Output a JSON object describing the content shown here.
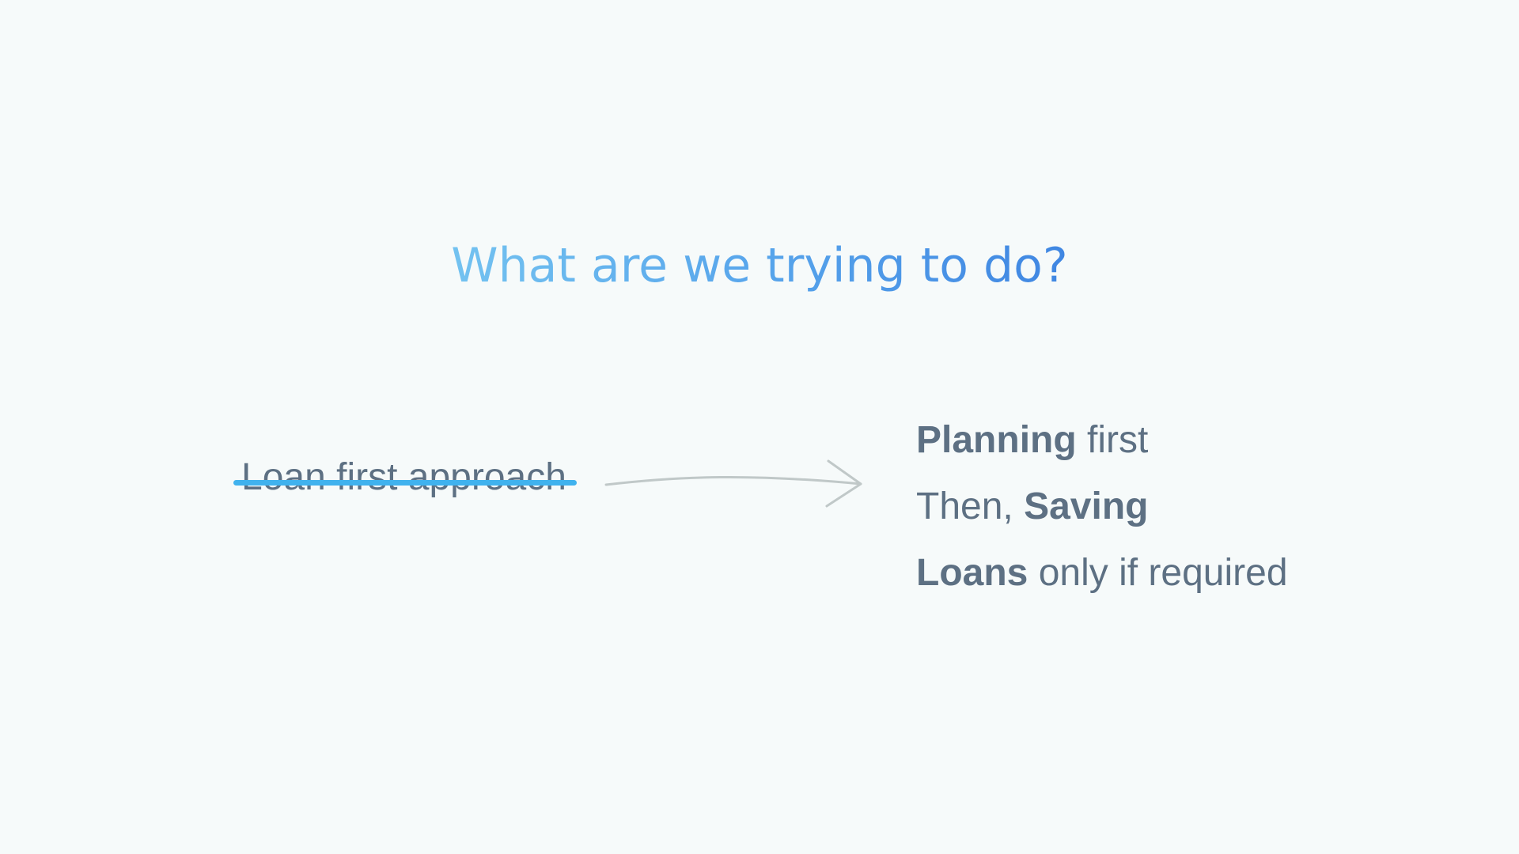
{
  "slide": {
    "title": "What are we trying to do?",
    "old_approach": "Loan first approach",
    "new_approach": [
      {
        "bold": "Planning",
        "after": " first"
      },
      {
        "before": "Then, ",
        "bold": "Saving"
      },
      {
        "bold": "Loans",
        "after": " only if required"
      }
    ]
  },
  "colors": {
    "background": "#f6fafa",
    "title_gradient_start": "#73c2f0",
    "title_gradient_end": "#3f86e2",
    "strike": "#40b2ee",
    "body_text": "#5d7083",
    "arrow": "#c0c8c8"
  },
  "icons": {
    "arrow": "right-arrow-icon"
  }
}
